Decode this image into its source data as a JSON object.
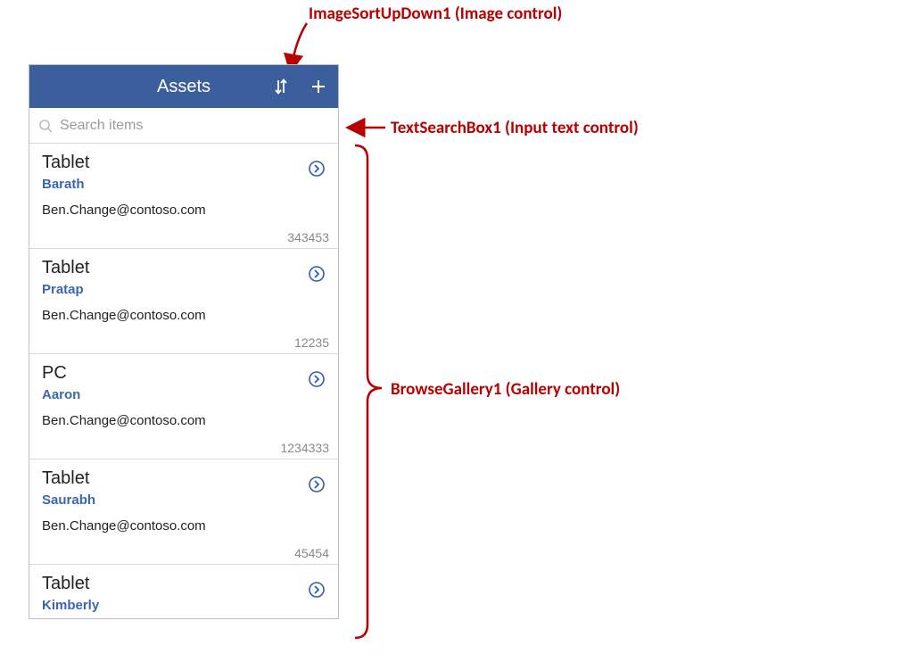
{
  "annotations": {
    "sort": "ImageSortUpDown1 (Image control)",
    "search": "TextSearchBox1 (Input text control)",
    "gallery": "BrowseGallery1 (Gallery control)"
  },
  "header": {
    "title": "Assets"
  },
  "search": {
    "placeholder": "Search items"
  },
  "items": [
    {
      "title": "Tablet",
      "name": "Barath",
      "email": "Ben.Change@contoso.com",
      "number": "343453"
    },
    {
      "title": "Tablet",
      "name": "Pratap",
      "email": "Ben.Change@contoso.com",
      "number": "12235"
    },
    {
      "title": "PC",
      "name": "Aaron",
      "email": "Ben.Change@contoso.com",
      "number": "1234333"
    },
    {
      "title": "Tablet",
      "name": "Saurabh",
      "email": "Ben.Change@contoso.com",
      "number": "45454"
    },
    {
      "title": "Tablet",
      "name": "Kimberly",
      "email": "",
      "number": ""
    }
  ],
  "colors": {
    "headerBg": "#3b5e9c",
    "link": "#3b66b0",
    "annotation": "#b70000"
  }
}
